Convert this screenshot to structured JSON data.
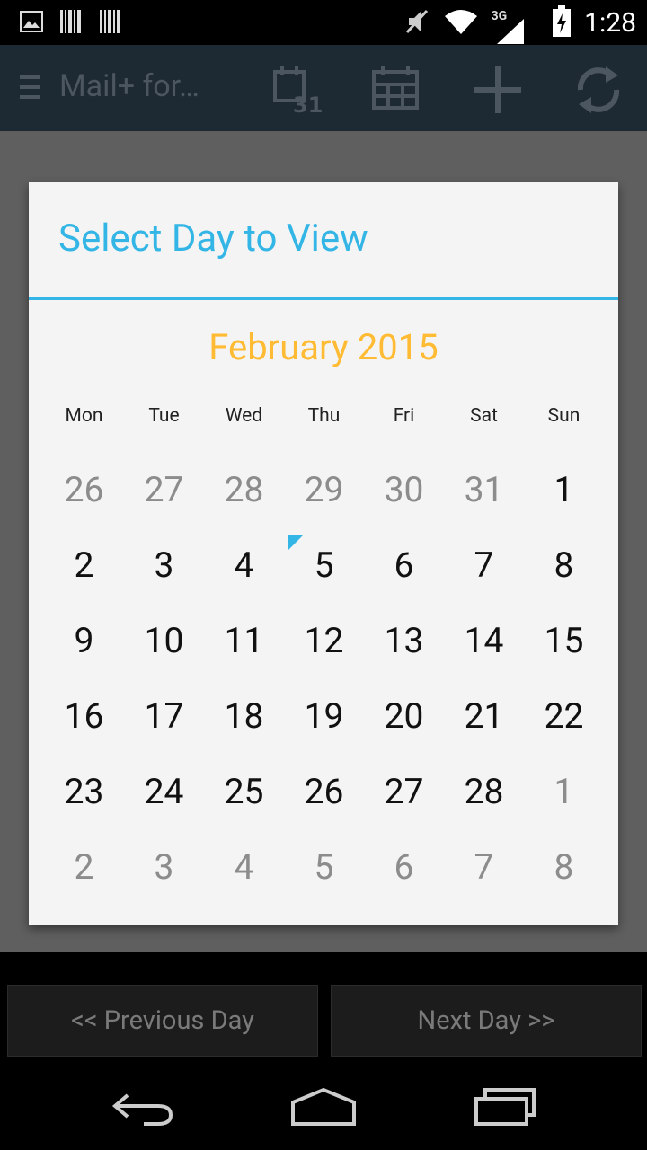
{
  "status_bar": {
    "time": "1:28",
    "network": "3G",
    "icons": [
      "image-icon",
      "barcode-icon",
      "barcode-icon",
      "mute-icon",
      "wifi-icon",
      "signal-icon",
      "battery-icon"
    ]
  },
  "action_bar": {
    "title": "Mail+ for…",
    "day_badge": "31",
    "icons": [
      "menu-icon",
      "calendar-day-icon",
      "calendar-month-icon",
      "add-icon",
      "refresh-icon"
    ]
  },
  "dialog": {
    "title": "Select Day to View",
    "month_title": "February 2015",
    "weekdays": [
      "Mon",
      "Tue",
      "Wed",
      "Thu",
      "Fri",
      "Sat",
      "Sun"
    ],
    "weeks": [
      [
        {
          "d": "26",
          "out": true
        },
        {
          "d": "27",
          "out": true
        },
        {
          "d": "28",
          "out": true
        },
        {
          "d": "29",
          "out": true
        },
        {
          "d": "30",
          "out": true
        },
        {
          "d": "31",
          "out": true
        },
        {
          "d": "1",
          "out": false
        }
      ],
      [
        {
          "d": "2",
          "out": false
        },
        {
          "d": "3",
          "out": false
        },
        {
          "d": "4",
          "out": false
        },
        {
          "d": "5",
          "out": false,
          "today": true
        },
        {
          "d": "6",
          "out": false
        },
        {
          "d": "7",
          "out": false
        },
        {
          "d": "8",
          "out": false
        }
      ],
      [
        {
          "d": "9",
          "out": false
        },
        {
          "d": "10",
          "out": false
        },
        {
          "d": "11",
          "out": false
        },
        {
          "d": "12",
          "out": false
        },
        {
          "d": "13",
          "out": false
        },
        {
          "d": "14",
          "out": false
        },
        {
          "d": "15",
          "out": false
        }
      ],
      [
        {
          "d": "16",
          "out": false
        },
        {
          "d": "17",
          "out": false
        },
        {
          "d": "18",
          "out": false
        },
        {
          "d": "19",
          "out": false
        },
        {
          "d": "20",
          "out": false
        },
        {
          "d": "21",
          "out": false
        },
        {
          "d": "22",
          "out": false
        }
      ],
      [
        {
          "d": "23",
          "out": false
        },
        {
          "d": "24",
          "out": false
        },
        {
          "d": "25",
          "out": false
        },
        {
          "d": "26",
          "out": false
        },
        {
          "d": "27",
          "out": false
        },
        {
          "d": "28",
          "out": false
        },
        {
          "d": "1",
          "out": true
        }
      ],
      [
        {
          "d": "2",
          "out": true
        },
        {
          "d": "3",
          "out": true
        },
        {
          "d": "4",
          "out": true
        },
        {
          "d": "5",
          "out": true
        },
        {
          "d": "6",
          "out": true
        },
        {
          "d": "7",
          "out": true
        },
        {
          "d": "8",
          "out": true
        }
      ]
    ]
  },
  "buttons": {
    "prev_label": "<< Previous Day",
    "next_label": "Next Day >>"
  },
  "nav_bar": {
    "icons": [
      "back-icon",
      "home-icon",
      "recent-apps-icon"
    ]
  },
  "colors": {
    "accent": "#33b5e5",
    "month": "#ffbb33",
    "dialog_bg": "#f4f4f4",
    "overlay": "#5f5f5f",
    "action_bar": "#1e2a33"
  }
}
